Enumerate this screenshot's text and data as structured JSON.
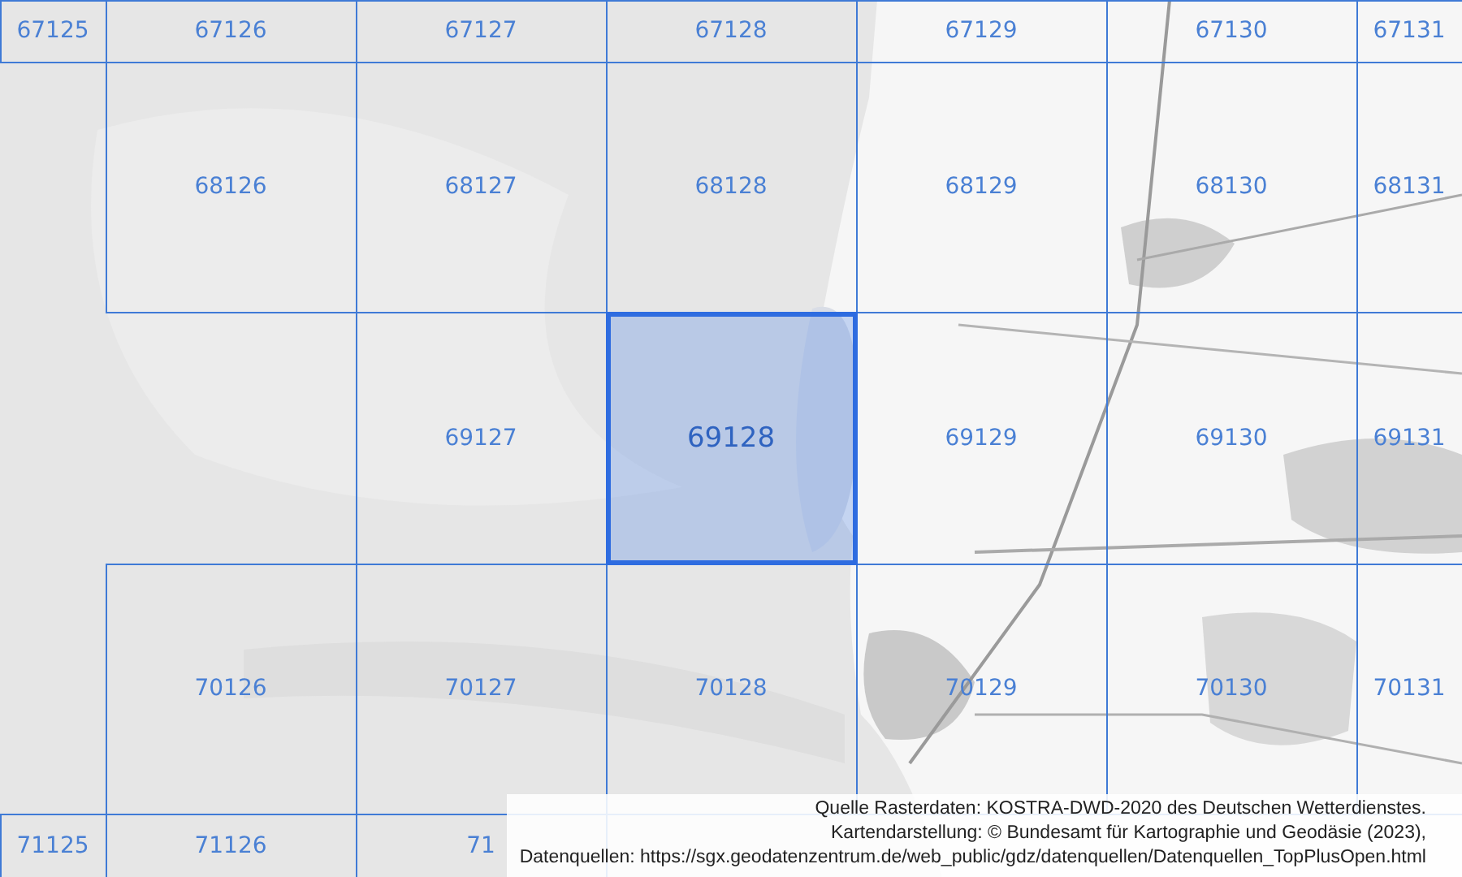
{
  "grid": [
    {
      "cells": [
        {
          "label": "67125",
          "selected": false
        },
        {
          "label": "67126",
          "selected": false
        },
        {
          "label": "67127",
          "selected": false
        },
        {
          "label": "67128",
          "selected": false
        },
        {
          "label": "67129",
          "selected": false
        },
        {
          "label": "67130",
          "selected": false
        },
        {
          "label": "67131",
          "selected": false
        }
      ]
    },
    {
      "cells": [
        null,
        {
          "label": "68126",
          "selected": false
        },
        {
          "label": "68127",
          "selected": false
        },
        {
          "label": "68128",
          "selected": false
        },
        {
          "label": "68129",
          "selected": false
        },
        {
          "label": "68130",
          "selected": false
        },
        {
          "label": "68131",
          "selected": false
        }
      ]
    },
    {
      "cells": [
        null,
        null,
        {
          "label": "69127",
          "selected": false
        },
        {
          "label": "69128",
          "selected": true
        },
        {
          "label": "69129",
          "selected": false
        },
        {
          "label": "69130",
          "selected": false
        },
        {
          "label": "69131",
          "selected": false
        }
      ]
    },
    {
      "cells": [
        null,
        {
          "label": "70126",
          "selected": false
        },
        {
          "label": "70127",
          "selected": false
        },
        {
          "label": "70128",
          "selected": false
        },
        {
          "label": "70129",
          "selected": false
        },
        {
          "label": "70130",
          "selected": false
        },
        {
          "label": "70131",
          "selected": false
        }
      ]
    },
    {
      "cells": [
        {
          "label": "71125",
          "selected": false
        },
        {
          "label": "71126",
          "selected": false
        },
        {
          "label": "71",
          "selected": false
        },
        null,
        null,
        null,
        null
      ]
    }
  ],
  "attribution": [
    "Quelle Rasterdaten: KOSTRA-DWD-2020 des Deutschen Wetterdienstes.",
    "Kartendarstellung: © Bundesamt für Kartographie und Geodäsie (2023),",
    "Datenquellen: https://sgx.geodatenzentrum.de/web_public/gdz/datenquellen/Datenquellen_TopPlusOpen.html"
  ]
}
